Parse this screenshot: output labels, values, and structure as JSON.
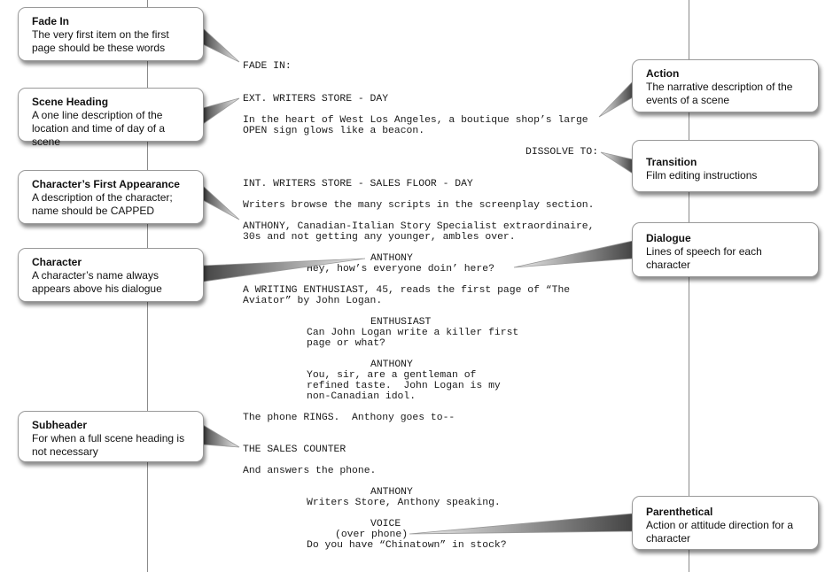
{
  "callouts": {
    "fade_in": {
      "title": "Fade In",
      "desc": "The very first item on the first page should be these words"
    },
    "scene_heading": {
      "title": "Scene Heading",
      "desc": "A one line description of the location and time of day of a scene"
    },
    "first_appearance": {
      "title": "Character’s First Appearance",
      "desc": "A description of the character; name should be CAPPED"
    },
    "character": {
      "title": "Character",
      "desc": "A character’s name always appears above his dialogue"
    },
    "subheader": {
      "title": "Subheader",
      "desc": "For when a full scene heading is not necessary"
    },
    "action": {
      "title": "Action",
      "desc": "The narrative description of the events of a scene"
    },
    "transition": {
      "title": "Transition",
      "desc": "Film editing instructions"
    },
    "dialogue": {
      "title": "Dialogue",
      "desc": "Lines of speech for each character"
    },
    "parenthetical": {
      "title": "Parenthetical",
      "desc": "Action or attitude direction for a character"
    }
  },
  "script": {
    "fade_in": "FADE IN:",
    "scene1_heading": "EXT. WRITERS STORE - DAY",
    "scene1_action": "In the heart of West Los Angeles, a boutique shop’s large\nOPEN sign glows like a beacon.",
    "transition": "DISSOLVE TO:",
    "scene2_heading": "INT. WRITERS STORE - SALES FLOOR - DAY",
    "scene2_action1": "Writers browse the many scripts in the screenplay section.",
    "scene2_action2": "ANTHONY, Canadian-Italian Story Specialist extraordinaire,\n30s and not getting any younger, ambles over.",
    "char1": "ANTHONY",
    "dial1": "Hey, how’s everyone doin’ here?",
    "action3": "A WRITING ENTHUSIAST, 45, reads the first page of “The\nAviator” by John Logan.",
    "char2": "ENTHUSIAST",
    "dial2": "Can John Logan write a killer first\npage or what?",
    "char3": "ANTHONY",
    "dial3": "You, sir, are a gentleman of\nrefined taste.  John Logan is my\nnon-Canadian idol.",
    "action4": "The phone RINGS.  Anthony goes to--",
    "subheader": "THE SALES COUNTER",
    "action5": "And answers the phone.",
    "char4": "ANTHONY",
    "dial4": "Writers Store, Anthony speaking.",
    "char5": "VOICE",
    "paren5": "(over phone)",
    "dial5": "Do you have “Chinatown” in stock?"
  }
}
